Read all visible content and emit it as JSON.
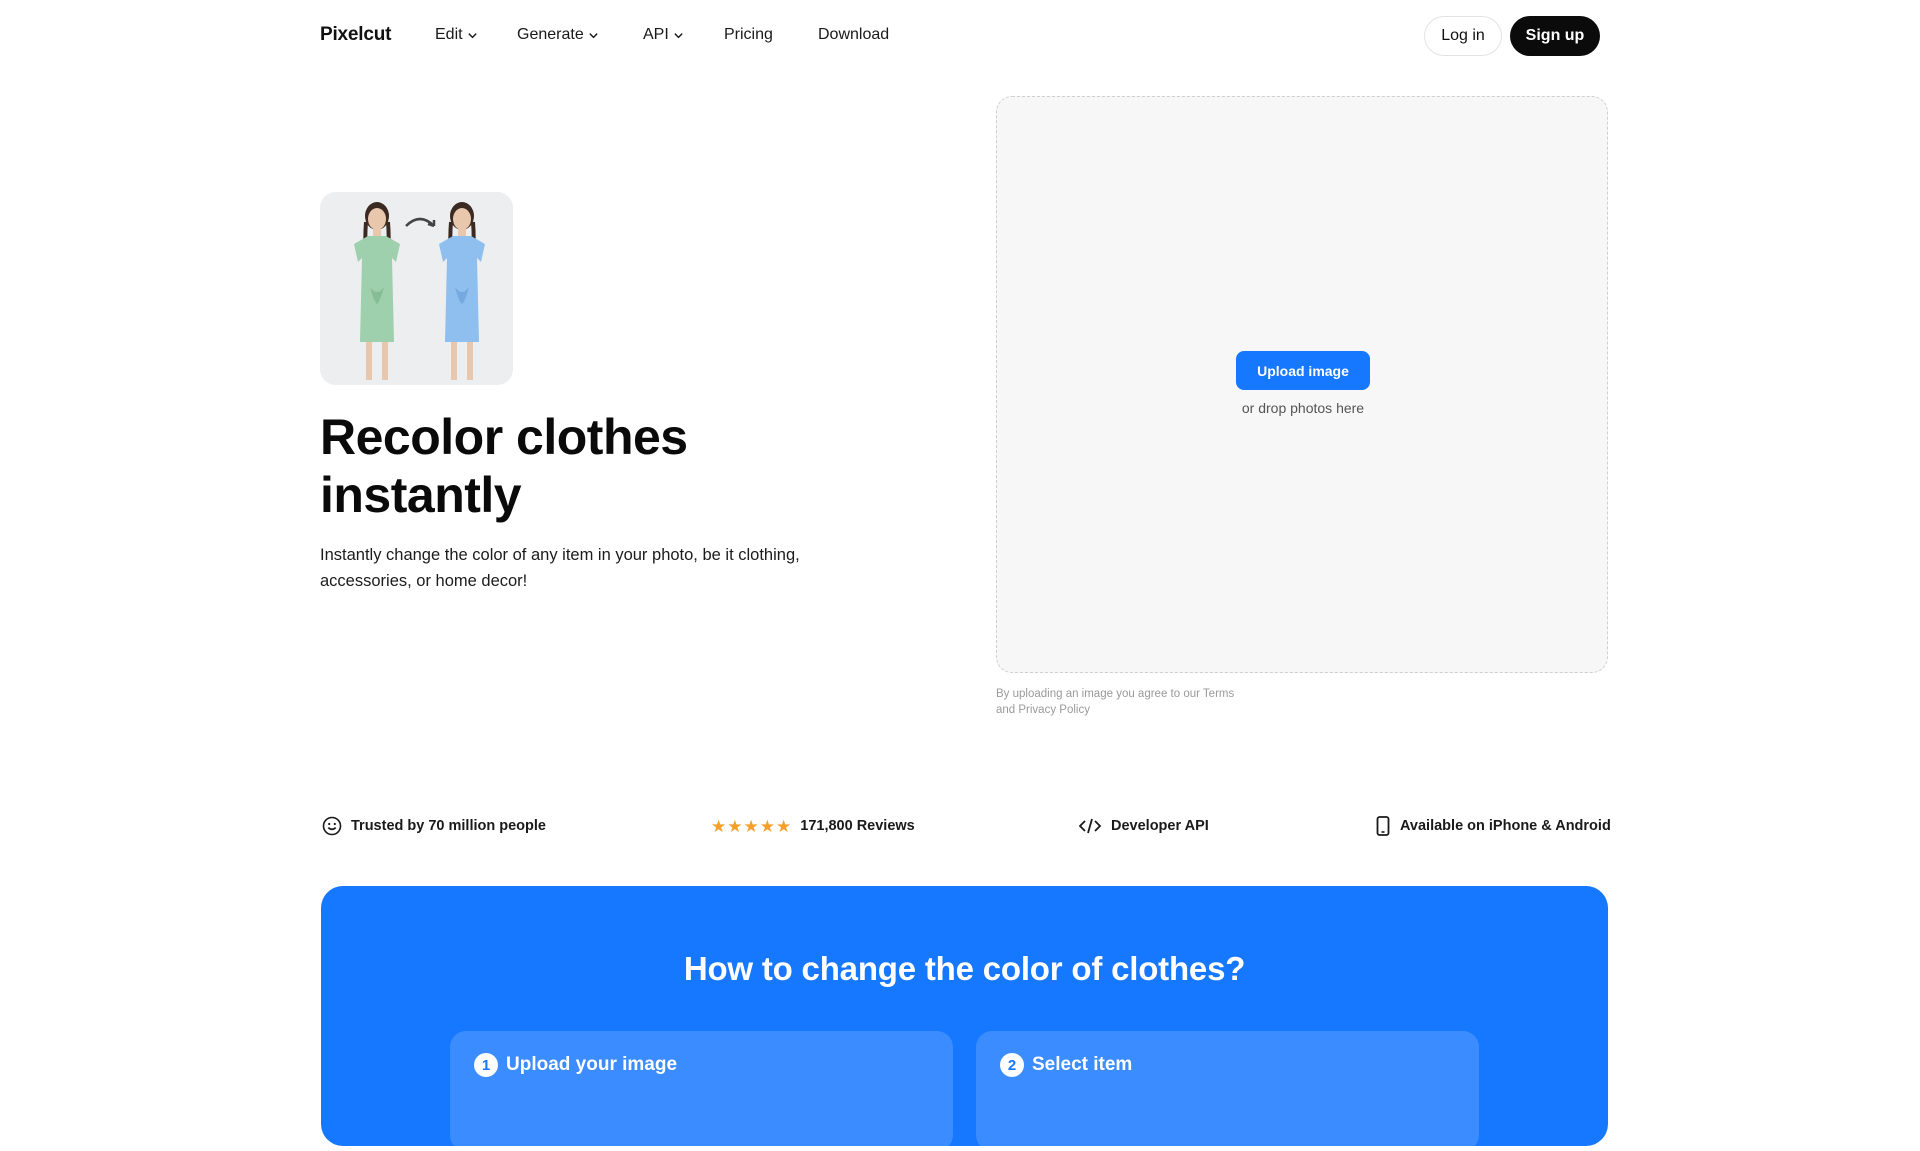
{
  "header": {
    "logo": "Pixelcut",
    "nav": [
      {
        "label": "Edit",
        "dropdown": true
      },
      {
        "label": "Generate",
        "dropdown": true
      },
      {
        "label": "API",
        "dropdown": true
      },
      {
        "label": "Pricing",
        "dropdown": false
      },
      {
        "label": "Download",
        "dropdown": false
      }
    ],
    "login_label": "Log in",
    "signup_label": "Sign up"
  },
  "hero": {
    "title": "Recolor clothes instantly",
    "description": "Instantly change the color of any item in your photo, be it clothing, accessories, or home decor!"
  },
  "upload": {
    "button_label": "Upload image",
    "hint": "or drop photos here",
    "terms": "By uploading an image you agree to our Terms and Privacy Policy"
  },
  "stats": {
    "trusted": "Trusted by 70 million people",
    "rating_stars": 5,
    "reviews": "171,800 Reviews",
    "api": "Developer API",
    "mobile": "Available on iPhone & Android"
  },
  "howto": {
    "title": "How to change the color of clothes?",
    "steps": [
      {
        "number": "1",
        "label": "Upload your image"
      },
      {
        "number": "2",
        "label": "Select item"
      }
    ]
  },
  "colors": {
    "accent": "#1677ff",
    "dark": "#0b0b0b",
    "star": "#f4a02b",
    "dress_before": "#9fd0ad",
    "dress_after": "#8fbfee"
  }
}
